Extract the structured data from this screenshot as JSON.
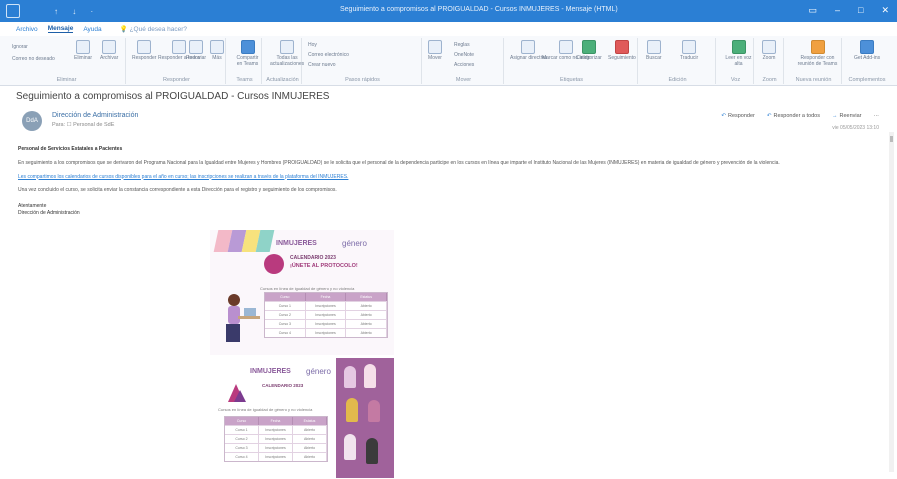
{
  "window": {
    "title": "Seguimiento a compromisos al PROIGUALDAD - Cursos INMUJERES - Mensaje (HTML)",
    "quick_access": "↑ ↓ ·",
    "controls": [
      "▭",
      "–",
      "□",
      "✕"
    ]
  },
  "ribbon_tabs": [
    "Archivo",
    "Mensaje",
    "Ayuda",
    "¿Qué desea hacer?"
  ],
  "ribbon": {
    "groups": [
      {
        "label": "Eliminar",
        "buttons": [
          "Ignorar",
          "Correo no deseado",
          "Eliminar",
          "Archivar"
        ]
      },
      {
        "label": "Responder",
        "buttons": [
          "Responder",
          "Responder a todos",
          "Reenviar",
          "Más"
        ]
      },
      {
        "label": "Teams",
        "buttons": [
          "Compartir en Teams"
        ]
      },
      {
        "label": "Actualización",
        "buttons": [
          "Todas las actualizaciones"
        ]
      },
      {
        "label": "Pasos rápidos",
        "buttons": [
          "Hoy",
          "Correo electrónico",
          "Crear nuevo"
        ]
      },
      {
        "label": "Mover",
        "buttons": [
          "Mover",
          "Reglas",
          "OneNote",
          "Acciones"
        ]
      },
      {
        "label": "Etiquetas",
        "buttons": [
          "Asignar directiva",
          "Marcar como no leído",
          "Categorizar",
          "Seguimiento"
        ]
      },
      {
        "label": "Edición",
        "buttons": [
          "Buscar",
          "Traducir"
        ]
      },
      {
        "label": "Voz",
        "buttons": [
          "Leer en voz alta"
        ]
      },
      {
        "label": "Zoom",
        "buttons": [
          "Zoom"
        ]
      },
      {
        "label": "Nueva reunión",
        "buttons": [
          "Responder con reunión de Teams"
        ]
      },
      {
        "label": "Complementos",
        "buttons": [
          "Get Add-ins"
        ]
      }
    ]
  },
  "message": {
    "subject": "Seguimiento a compromisos al PROIGUALDAD - Cursos INMUJERES",
    "sender": "Dirección de Administración",
    "recipient": "Para: ☐ Personal de SdE",
    "avatar_initials": "DdA",
    "datetime": "vie 05/05/2023 13:10",
    "actions": [
      "Responder",
      "Responder a todos",
      "Reenviar",
      "···"
    ],
    "greeting": "Personal de Servicios Estatales a Pacientes",
    "paragraph1": "En seguimiento a los compromisos que se derivaron del Programa Nacional para la Igualdad entre Mujeres y Hombres (PROIGUALDAD) se le solicita que el personal de la dependencia participe en los cursos en línea que imparte el Instituto Nacional de las Mujeres (INMUJERES) en materia de igualdad de género y prevención de la violencia.",
    "paragraph2": "Les compartimos los calendarios de cursos disponibles para el año en curso; las inscripciones se realizan a través de la plataforma del INMUJERES.",
    "paragraph3": "Una vez concluido el curso, se solicita enviar la constancia correspondiente a esta Dirección para el registro y seguimiento de los compromisos.",
    "closing": "Atentamente",
    "closing_name": "Dirección de Administración"
  },
  "poster": {
    "panel1": {
      "logo_text": "INMUJERES",
      "logo_right": "género",
      "calendar_title": "CALENDARIO 2023",
      "headline": "¡ÚNETE AL PROTOCOLO!",
      "caption": "Cursos en línea de igualdad de género y no violencia",
      "table_header": [
        "Curso",
        "Fecha",
        "Estatus"
      ],
      "table_rows": [
        [
          "Curso 1",
          "Inscripciones",
          "Abierto"
        ],
        [
          "Curso 2",
          "Inscripciones",
          "Abierto"
        ],
        [
          "Curso 3",
          "Inscripciones",
          "Abierto"
        ],
        [
          "Curso 4",
          "Inscripciones",
          "Abierto"
        ]
      ]
    },
    "panel2": {
      "logo_text": "INMUJERES",
      "logo_right": "género",
      "calendar_title": "CALENDARIO 2023",
      "caption": "Cursos en línea de igualdad de género y no violencia",
      "table_header": [
        "Curso",
        "Fecha",
        "Estatus"
      ],
      "table_rows": [
        [
          "Curso 1",
          "Inscripciones",
          "Abierto"
        ],
        [
          "Curso 2",
          "Inscripciones",
          "Abierto"
        ],
        [
          "Curso 3",
          "Inscripciones",
          "Abierto"
        ],
        [
          "Curso 4",
          "Inscripciones",
          "Abierto"
        ]
      ]
    }
  },
  "colors": {
    "titlebar": "#2b7fd4",
    "accent": "#1d5fa8",
    "poster_purple": "#a0629b",
    "poster_magenta": "#b93a7e"
  }
}
